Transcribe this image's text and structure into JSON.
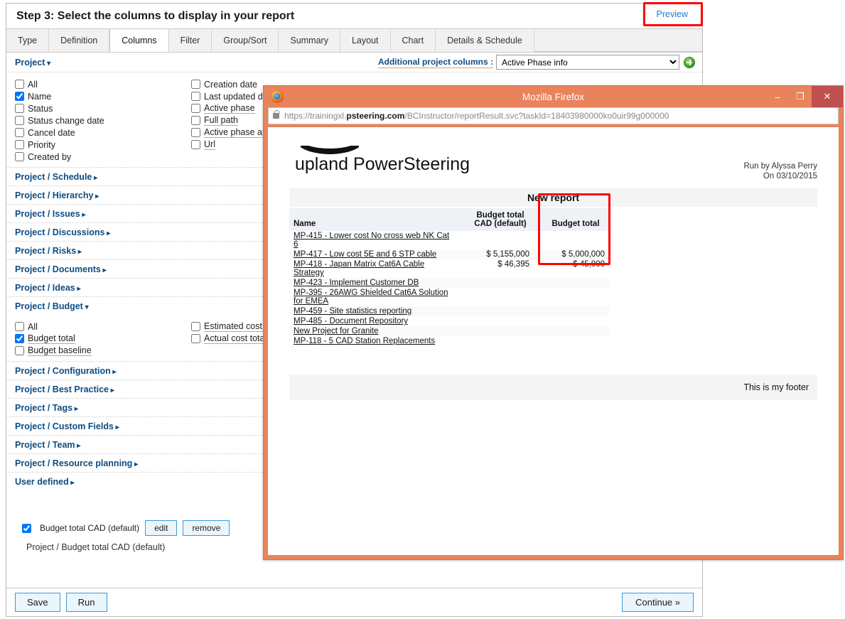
{
  "wizard": {
    "step_title": "Step 3: Select the columns to display in your report",
    "preview_label": "Preview",
    "tabs": [
      {
        "label": "Type",
        "active": false
      },
      {
        "label": "Definition",
        "active": false
      },
      {
        "label": "Columns",
        "active": true
      },
      {
        "label": "Filter",
        "active": false
      },
      {
        "label": "Group/Sort",
        "active": false
      },
      {
        "label": "Summary",
        "active": false
      },
      {
        "label": "Layout",
        "active": false
      },
      {
        "label": "Chart",
        "active": false
      },
      {
        "label": "Details & Schedule",
        "active": false
      }
    ],
    "project_group_label": "Project",
    "additional_columns_label": "Additional project columns :",
    "additional_columns_value": "Active Phase info",
    "additional_columns_options": [
      "Active Phase info"
    ],
    "project_columns": {
      "left": [
        {
          "label": "All",
          "checked": false,
          "underline": false
        },
        {
          "label": "Name",
          "checked": true,
          "underline": false
        },
        {
          "label": "Status",
          "checked": false,
          "underline": false
        },
        {
          "label": "Status change date",
          "checked": false,
          "underline": false
        },
        {
          "label": "Cancel date",
          "checked": false,
          "underline": false
        },
        {
          "label": "Priority",
          "checked": false,
          "underline": false
        },
        {
          "label": "Created by",
          "checked": false,
          "underline": false
        }
      ],
      "right": [
        {
          "label": "Creation date",
          "checked": false,
          "underline": false
        },
        {
          "label": "Last updated date",
          "checked": false,
          "underline": false
        },
        {
          "label": "Active phase",
          "checked": false,
          "underline": true
        },
        {
          "label": "Full path",
          "checked": false,
          "underline": true
        },
        {
          "label": "Active phase approver",
          "checked": false,
          "underline": true
        },
        {
          "label": "Url",
          "checked": false,
          "underline": true
        }
      ]
    },
    "sections_before_budget": [
      "Project / Schedule",
      "Project / Hierarchy",
      "Project / Issues",
      "Project / Discussions",
      "Project / Risks",
      "Project / Documents",
      "Project / Ideas"
    ],
    "budget_group_label": "Project / Budget",
    "budget_columns": {
      "left": [
        {
          "label": "All",
          "checked": false,
          "underline": false
        },
        {
          "label": "Budget total",
          "checked": true,
          "underline": true
        },
        {
          "label": "Budget baseline",
          "checked": false,
          "underline": true
        }
      ],
      "right": [
        {
          "label": "Estimated cost total",
          "checked": false,
          "underline": true
        },
        {
          "label": "Actual cost total",
          "checked": false,
          "underline": true
        }
      ]
    },
    "sections_after_budget": [
      "Project / Configuration",
      "Project / Best Practice",
      "Project / Tags",
      "Project / Custom Fields",
      "Project / Team",
      "Project / Resource planning",
      "User defined"
    ],
    "selected_column": {
      "label": "Budget total CAD (default)",
      "checked": true,
      "edit_label": "edit",
      "remove_label": "remove",
      "path": "Project / Budget total CAD (default)"
    },
    "footer": {
      "save_label": "Save",
      "run_label": "Run",
      "continue_label": "Continue »"
    }
  },
  "browser": {
    "title": "Mozilla Firefox",
    "minimize_label": "–",
    "maximize_label": "❐",
    "close_label": "✕",
    "url_parts": {
      "prefix": "https://trainingxl.",
      "domain": "psteering.com",
      "path": "/BCInstructor/reportResult.svc?taskId=18403980000ko0uir99g000000"
    }
  },
  "report": {
    "logo_brand": "upland",
    "logo_product": "PowerSteering",
    "run_by": "Run by Alyssa Perry",
    "run_on": "On 03/10/2015",
    "title": "New report",
    "columns": [
      "Name",
      "Budget total CAD (default)",
      "Budget total"
    ],
    "rows": [
      {
        "name": "MP-415 - Lower cost No cross web NK Cat 6",
        "cad": "",
        "total": ""
      },
      {
        "name": "MP-417 - Low cost 5E and 6 STP cable",
        "cad": "$ 5,155,000",
        "total": "$ 5,000,000"
      },
      {
        "name": "MP-418 - Japan Matrix Cat6A Cable Strategy",
        "cad": "$ 46,395",
        "total": "$ 45,000"
      },
      {
        "name": "MP-423 - Implement Customer DB",
        "cad": "",
        "total": ""
      },
      {
        "name": "MP-395 - 26AWG Shielded Cat6A Solution for EMEA",
        "cad": "",
        "total": ""
      },
      {
        "name": "MP-459 - Site statistics reporting",
        "cad": "",
        "total": ""
      },
      {
        "name": "MP-485 - Document Repository",
        "cad": "",
        "total": ""
      },
      {
        "name": "New Project for Granite",
        "cad": "",
        "total": ""
      },
      {
        "name": "MP-118 - 5 CAD Station Replacements",
        "cad": "",
        "total": ""
      }
    ],
    "footer_text": "This is my footer"
  },
  "colors": {
    "highlight_red": "#ff0000",
    "firefox_chrome": "#e8835c",
    "close_button": "#c0504d",
    "link_blue": "#0f4c81",
    "preview_blue": "#1a7ec8",
    "underline_orange": "#e8a33d"
  }
}
